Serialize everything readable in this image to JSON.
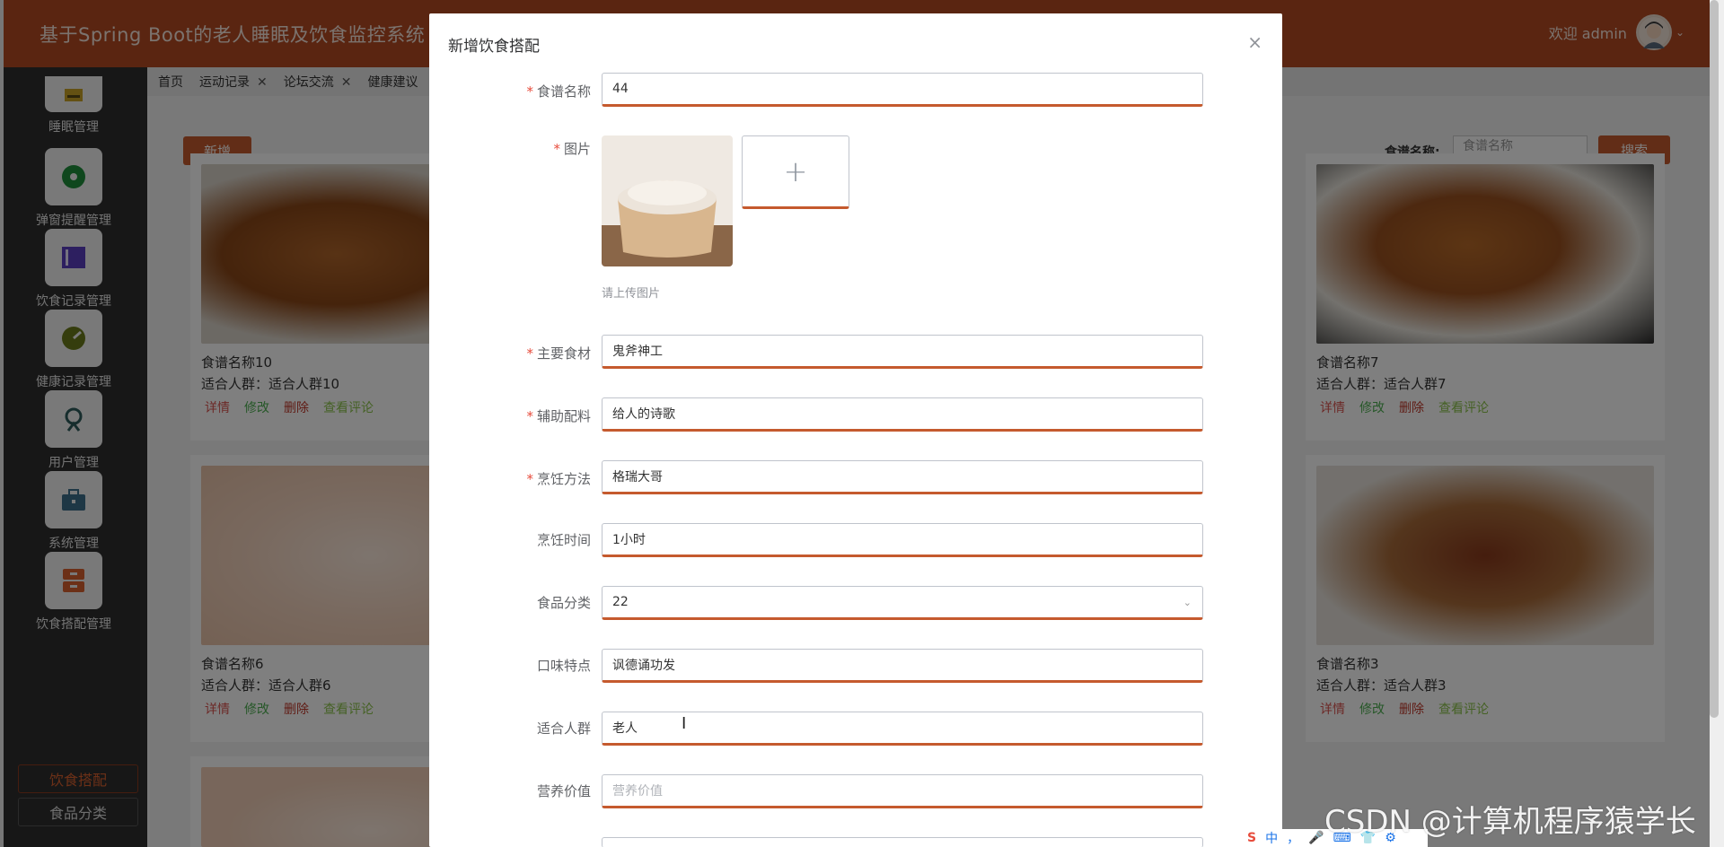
{
  "header": {
    "title": "基于Spring Boot的老人睡眠及饮食监控系统",
    "welcome": "欢迎 admin"
  },
  "sidebar": {
    "items": [
      {
        "label": "睡眠管理",
        "icon": "sleep-icon"
      },
      {
        "label": "弹窗提醒管理",
        "icon": "popup-icon"
      },
      {
        "label": "饮食记录管理",
        "icon": "diet-record-icon"
      },
      {
        "label": "健康记录管理",
        "icon": "health-icon"
      },
      {
        "label": "用户管理",
        "icon": "user-icon"
      },
      {
        "label": "系统管理",
        "icon": "system-icon"
      },
      {
        "label": "饮食搭配管理",
        "icon": "diet-match-icon"
      }
    ],
    "sub_items": [
      {
        "label": "饮食搭配",
        "active": true
      },
      {
        "label": "食品分类",
        "active": false
      }
    ]
  },
  "tabs": [
    {
      "label": "首页",
      "closable": false
    },
    {
      "label": "运动记录",
      "closable": true
    },
    {
      "label": "论坛交流",
      "closable": true
    },
    {
      "label": "健康建议",
      "closable": false
    }
  ],
  "toolbar": {
    "add_label": "新增",
    "search_label": "食谱名称:",
    "search_placeholder": "食谱名称",
    "search_button": "搜索"
  },
  "cards": [
    {
      "name": "食谱名称10",
      "crowd": "适合人群：适合人群10"
    },
    {
      "name": "食谱名称7",
      "crowd": "适合人群：适合人群7"
    },
    {
      "name": "食谱名称6",
      "crowd": "适合人群：适合人群6"
    },
    {
      "name": "食谱名称3",
      "crowd": "适合人群：适合人群3"
    }
  ],
  "card_actions": {
    "detail": "详情",
    "edit": "修改",
    "delete": "删除",
    "comment": "查看评论"
  },
  "dialog": {
    "title": "新增饮食搭配",
    "upload_tip": "请上传图片",
    "fields": {
      "recipe_name": {
        "label": "食谱名称",
        "value": "44",
        "required": true
      },
      "image": {
        "label": "图片",
        "required": true
      },
      "main_ingredient": {
        "label": "主要食材",
        "value": "鬼斧神工",
        "required": true
      },
      "aux_ingredient": {
        "label": "辅助配料",
        "value": "给人的诗歌",
        "required": true
      },
      "cooking_method": {
        "label": "烹饪方法",
        "value": "格瑞大哥",
        "required": true
      },
      "cooking_time": {
        "label": "烹饪时间",
        "value": "1小时",
        "required": false
      },
      "food_category": {
        "label": "食品分类",
        "value": "22",
        "required": false
      },
      "taste": {
        "label": "口味特点",
        "value": "讽德诵功发",
        "required": false
      },
      "crowd": {
        "label": "适合人群",
        "value": "老人",
        "required": false
      },
      "nutrition": {
        "label": "营养价值",
        "placeholder": "营养价值",
        "required": false
      }
    }
  },
  "watermark": "CSDN @计算机程序猿学长",
  "ime": [
    "中",
    "，",
    "🎤",
    "⌨",
    "👕",
    "⚙"
  ],
  "colors": {
    "brand": "#b54a23",
    "accent": "#c55a2e"
  }
}
